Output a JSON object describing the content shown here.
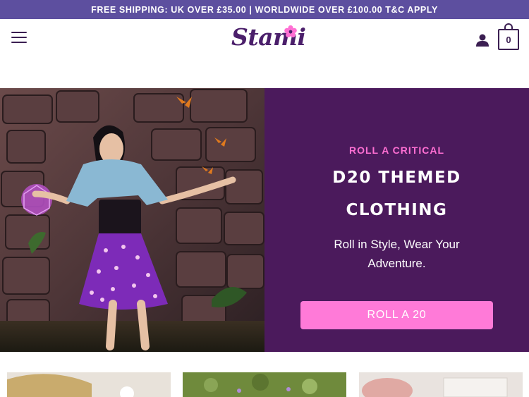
{
  "announcement": {
    "text": "FREE SHIPPING: UK OVER £35.00 | WORLDWIDE OVER £100.00 T&C APPLY"
  },
  "header": {
    "logo_text": "Stami",
    "cart_count": "0",
    "menu_icon": "hamburger-menu-icon",
    "user_icon": "user-account-icon",
    "cart_icon": "shopping-bag-icon"
  },
  "hero": {
    "eyebrow": "ROLL A CRITICAL",
    "headline_line1": "D20 THEMED",
    "headline_line2": "CLOTHING",
    "subtitle": "Roll in Style, Wear Your Adventure.",
    "cta_label": "ROLL A 20"
  },
  "colors": {
    "announcement_bg": "#5d4f9f",
    "brand_purple": "#4b1f6b",
    "hero_panel_bg": "#4b1a5c",
    "accent_pink": "#ff6fd3",
    "cta_bg": "#ff7ad8"
  }
}
